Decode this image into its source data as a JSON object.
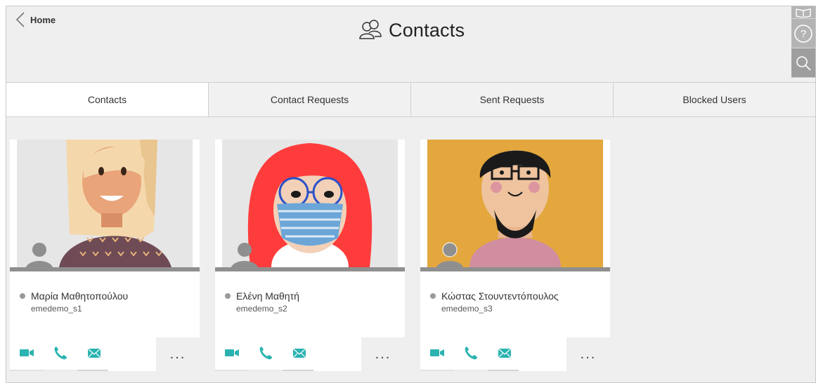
{
  "header": {
    "back_label": "Home",
    "title": "Contacts"
  },
  "tabs": [
    {
      "label": "Contacts",
      "active": true
    },
    {
      "label": "Contact Requests",
      "active": false
    },
    {
      "label": "Sent Requests",
      "active": false
    },
    {
      "label": "Blocked Users",
      "active": false
    }
  ],
  "contacts": [
    {
      "name": "Μαρία Μαθητοπούλου",
      "username": "emedemo_s1",
      "status": "offline"
    },
    {
      "name": "Ελένη Μαθητή",
      "username": "emedemo_s2",
      "status": "offline"
    },
    {
      "name": "Κώστας Στουντεντόπουλος",
      "username": "emedemo_s3",
      "status": "offline"
    }
  ],
  "card_actions": {
    "more_label": "..."
  },
  "colors": {
    "accent": "#2bb3b1",
    "status_offline": "#9a9a9a",
    "toolbar": "#b4b4b4"
  },
  "icons": [
    "back-chevron-icon",
    "contacts-icon",
    "book-icon",
    "help-icon",
    "search-icon",
    "video-call-icon",
    "phone-icon",
    "mail-icon",
    "avatar-icon"
  ]
}
